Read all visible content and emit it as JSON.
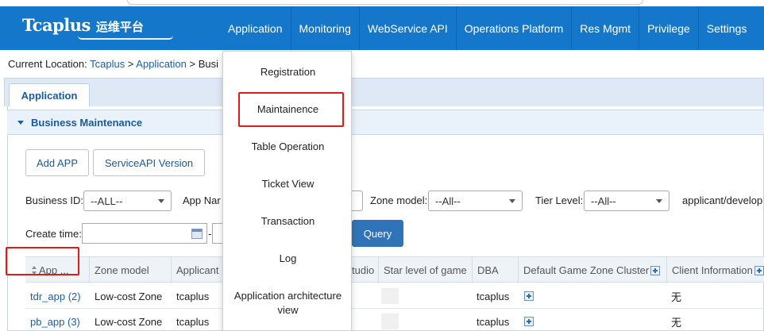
{
  "header": {
    "logo_text": "Tcaplus",
    "logo_sub": "运维平台",
    "nav": [
      "Application",
      "Monitoring",
      "WebService API",
      "Operations Platform",
      "Res Mgmt",
      "Privilege",
      "Settings"
    ]
  },
  "breadcrumb": {
    "prefix": "Current Location: ",
    "items": [
      "Tcaplus",
      "Application"
    ],
    "separator": " > ",
    "tail": "Busi"
  },
  "tab": {
    "label": "Application"
  },
  "section": {
    "title": "Business Maintenance"
  },
  "buttons": {
    "add_app": "Add APP",
    "serviceapi_version": "ServiceAPI Version",
    "query": "Query"
  },
  "filters": {
    "business_id_label": "Business ID:",
    "business_id_value": "--ALL--",
    "app_name_label": "App Nar",
    "zone_model_label": "Zone model:",
    "zone_model_value": "--All--",
    "tier_level_label": "Tier Level:",
    "tier_level_value": "--All--",
    "applicant_label": "applicant/develop",
    "create_time_label": "Create time:",
    "date_separator": "-"
  },
  "table": {
    "columns": [
      "App ...",
      "Zone model",
      "Applicant",
      "tudio",
      "Star level of game",
      "DBA",
      "Default Game Zone Cluster",
      "Client Information"
    ],
    "rows": [
      {
        "app": "tdr_app (2)",
        "zone": "Low-cost Zone",
        "applicant": "tcaplus",
        "dba": "tcaplus",
        "client": "无"
      },
      {
        "app": "pb_app (3)",
        "zone": "Low-cost Zone",
        "applicant": "tcaplus",
        "dba": "tcaplus",
        "client": "无"
      }
    ]
  },
  "menu": {
    "items": [
      "Registration",
      "Maintainence",
      "Table Operation",
      "Ticket View",
      "Transaction",
      "Log",
      "Application architecture view"
    ]
  },
  "colors": {
    "header_bg": "#1577c9",
    "highlight": "#e01b1b",
    "link": "#1a5fa8",
    "query_bg": "#2f74b8"
  }
}
